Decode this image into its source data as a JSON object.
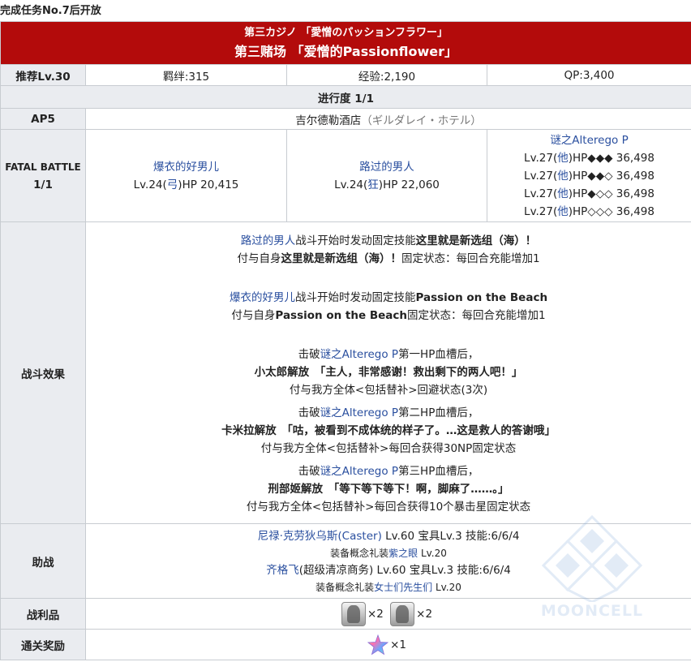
{
  "unlock_condition": "完成任务No.7后开放",
  "header": {
    "subtitle": "第三カジノ 「愛憎のパッションフラワー」",
    "title": "第三赌场 「爱憎的Passionflower」"
  },
  "stats": {
    "recommend": "推荐Lv.30",
    "bond": "羁绊:315",
    "exp": "经验:2,190",
    "qp": "QP:3,400"
  },
  "progress": "进行度 1/1",
  "ap": {
    "label": "AP5",
    "location": "吉尔德勒酒店",
    "location_jp": "（ギルダレイ・ホテル）"
  },
  "battle": {
    "label_1": "FATAL BATTLE",
    "label_2": "1/1",
    "enemies": [
      {
        "name": "爆衣的好男儿",
        "lv": "Lv.24(",
        "cls": "弓",
        "hp": ")HP 20,415"
      },
      {
        "name": "路过的男人",
        "lv": "Lv.24(",
        "cls": "狂",
        "hp": ")HP 22,060"
      }
    ],
    "boss": {
      "name": "谜之Alterego P",
      "bars": [
        {
          "lv": "Lv.27(",
          "cls": "他",
          "hp": ")HP◆◆◆ 36,498"
        },
        {
          "lv": "Lv.27(",
          "cls": "他",
          "hp": ")HP◆◆◇ 36,498"
        },
        {
          "lv": "Lv.27(",
          "cls": "他",
          "hp": ")HP◆◇◇ 36,498"
        },
        {
          "lv": "Lv.27(",
          "cls": "他",
          "hp": ")HP◇◇◇ 36,498"
        }
      ]
    }
  },
  "effects": {
    "label": "战斗效果",
    "b1": {
      "who": "路过的男人",
      "mid": "战斗开始时发动固定技能",
      "skill": "这里就是新选组（海）！"
    },
    "b2": {
      "pre": "付与自身",
      "skill": "这里就是新选组（海）！",
      "post": "固定状态：每回合充能增加1"
    },
    "b3": {
      "who": "爆衣的好男儿",
      "mid": "战斗开始时发动固定技能",
      "skill": "Passion on the Beach"
    },
    "b4": {
      "pre": "付与自身",
      "skill": "Passion on the Beach",
      "post": "固定状态：每回合充能增加1"
    },
    "g1": {
      "pre": "击破",
      "who": "谜之Alterego P",
      "post": "第一HP血槽后，",
      "release": "小太郎解放　「主人，非常感谢！救出剩下的两人吧！」",
      "effect": "付与我方全体<包括替补>回避状态(3次)"
    },
    "g2": {
      "pre": "击破",
      "who": "谜之Alterego P",
      "post": "第二HP血槽后，",
      "release": "卡米拉解放　「咕，被看到不成体统的样子了。…这是救人的答谢哦」",
      "effect": "付与我方全体<包括替补>每回合获得30NP固定状态"
    },
    "g3": {
      "pre": "击破",
      "who": "谜之Alterego P",
      "post": "第三HP血槽后，",
      "release": "刑部姬解放　「等下等下等下！啊，脚麻了……。」",
      "effect": "付与我方全体<包括替补>每回合获得10个暴击星固定状态"
    }
  },
  "support": {
    "label": "助战",
    "s1": {
      "name": "尼禄·克劳狄乌斯(Caster)",
      "info": " Lv.60 宝具Lv.3 技能:6/6/4",
      "ce_pre": "装备概念礼装",
      "ce": "紫之眼",
      "ce_lv": " Lv.20"
    },
    "s2": {
      "name": "齐格飞",
      "name_suffix": "(超级清凉商务)",
      "info": " Lv.60 宝具Lv.3 技能:6/6/4",
      "ce_pre": "装备概念礼装",
      "ce": "女士们先生们",
      "ce_lv": " Lv.20"
    }
  },
  "drops": {
    "label": "战利品",
    "items": [
      {
        "icon": "statue-item-icon",
        "qty": "×2"
      },
      {
        "icon": "statue-item-icon",
        "qty": "×2"
      }
    ]
  },
  "reward": {
    "label": "通关奖励",
    "icon": "saint-quartz-icon",
    "qty": "×1"
  },
  "watermark": "MOONCELL",
  "colors": {
    "header_red": "#b30b0b",
    "link_blue": "#2a4f9f",
    "label_gray": "#eaecf0",
    "border": "#c8ccd1"
  }
}
